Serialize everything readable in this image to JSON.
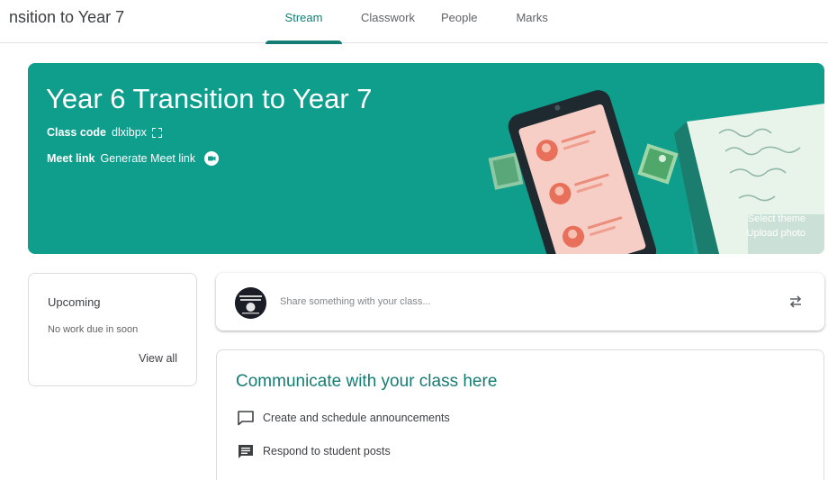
{
  "header": {
    "class_title": "nsition to Year 7",
    "tabs": [
      {
        "label": "Stream",
        "active": true
      },
      {
        "label": "Classwork",
        "active": false
      },
      {
        "label": "People",
        "active": false
      },
      {
        "label": "Marks",
        "active": false
      }
    ]
  },
  "banner": {
    "title": "Year 6 Transition to Year 7",
    "class_code_label": "Class code",
    "class_code_value": "dlxibpx",
    "meet_link_label": "Meet link",
    "meet_link_value": "Generate Meet link",
    "select_theme": "Select theme",
    "upload_photo": "Upload photo",
    "icons": [
      "expand-icon",
      "meet-icon"
    ]
  },
  "upcoming": {
    "title": "Upcoming",
    "message": "No work due in soon",
    "view_all": "View all"
  },
  "share": {
    "placeholder": "Share something with your class...",
    "icons": [
      "avatar",
      "repost-icon"
    ]
  },
  "communicate": {
    "title": "Communicate with your class here",
    "items": [
      {
        "label": "Create and schedule announcements",
        "icon": "announcement-icon"
      },
      {
        "label": "Respond to student posts",
        "icon": "comments-icon"
      }
    ]
  },
  "colors": {
    "accent": "#137d74",
    "banner": "#0f9d8c"
  }
}
